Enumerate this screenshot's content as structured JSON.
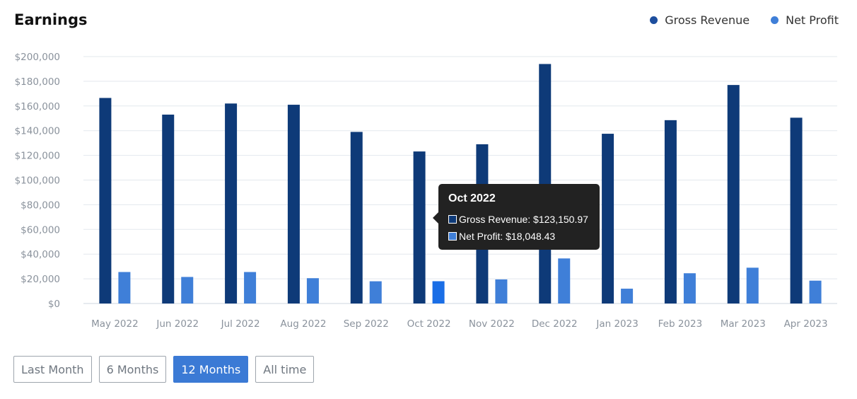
{
  "header": {
    "title": "Earnings"
  },
  "legend": [
    {
      "label": "Gross Revenue",
      "color": "#1d4e9e"
    },
    {
      "label": "Net Profit",
      "color": "#3f7fd8"
    }
  ],
  "filters": [
    {
      "label": "Last Month",
      "active": false
    },
    {
      "label": "6 Months",
      "active": false
    },
    {
      "label": "12 Months",
      "active": true
    },
    {
      "label": "All time",
      "active": false
    }
  ],
  "tooltip": {
    "title": "Oct 2022",
    "rows": [
      {
        "text": "Gross Revenue: $123,150.97",
        "color": "#0e3a78"
      },
      {
        "text": "Net Profit: $18,048.43",
        "color": "#3f7fd8"
      }
    ]
  },
  "chart_data": {
    "type": "bar",
    "categories": [
      "May 2022",
      "Jun 2022",
      "Jul 2022",
      "Aug 2022",
      "Sep 2022",
      "Oct 2022",
      "Nov 2022",
      "Dec 2022",
      "Jan 2023",
      "Feb 2023",
      "Mar 2023",
      "Apr 2023"
    ],
    "series": [
      {
        "name": "Gross Revenue",
        "color": "#0e3a78",
        "values": [
          166500,
          153000,
          162000,
          161000,
          139000,
          123150.97,
          129000,
          194000,
          137500,
          148500,
          177000,
          150500
        ]
      },
      {
        "name": "Net Profit",
        "color": "#3f7fd8",
        "values": [
          25500,
          21500,
          25500,
          20500,
          18000,
          18048.43,
          19500,
          36500,
          12000,
          24500,
          29000,
          18500
        ]
      }
    ],
    "highlight": {
      "category": "Oct 2022",
      "color": "#1a6ee6"
    },
    "ylim": [
      0,
      200000
    ],
    "yticks": [
      "$0",
      "$20,000",
      "$40,000",
      "$60,000",
      "$80,000",
      "$100,000",
      "$120,000",
      "$140,000",
      "$160,000",
      "$180,000",
      "$200,000"
    ],
    "grid": true,
    "legend_position": "top-right"
  }
}
